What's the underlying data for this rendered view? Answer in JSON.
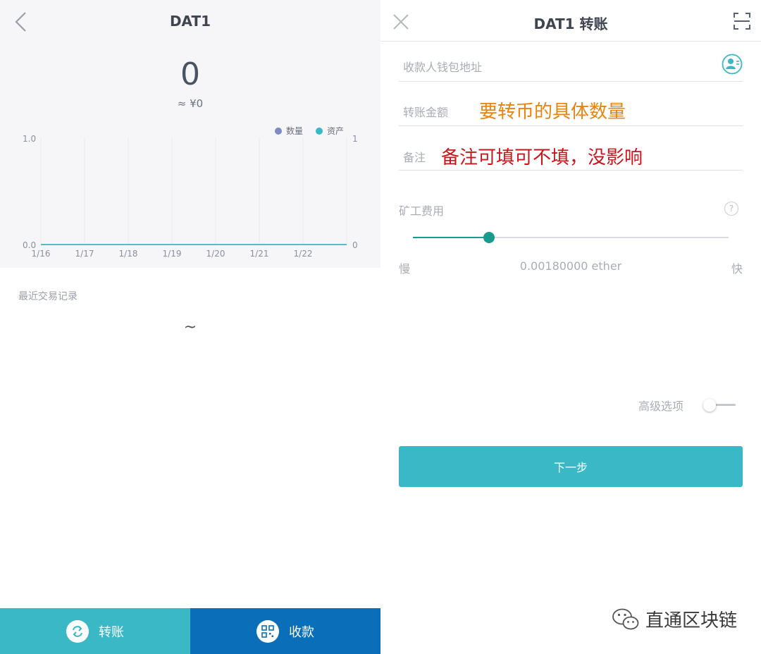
{
  "left": {
    "title": "DAT1",
    "balance": "0",
    "balance_fiat": "≈ ¥0",
    "records_label": "最近交易记录",
    "records_empty": "~",
    "bottom": {
      "transfer_label": "转账",
      "receive_label": "收款"
    }
  },
  "chart_data": {
    "type": "line",
    "x": [
      "1/16",
      "1/17",
      "1/18",
      "1/19",
      "1/20",
      "1/21",
      "1/22"
    ],
    "series": [
      {
        "name": "数量",
        "values": [
          0,
          0,
          0,
          0,
          0,
          0,
          0
        ],
        "color": "#7e8ac4"
      },
      {
        "name": "资产",
        "values": [
          0,
          0,
          0,
          0,
          0,
          0,
          0
        ],
        "color": "#3bb8c6"
      }
    ],
    "y_left_ticks": [
      "1.0",
      "0.0"
    ],
    "y_right_ticks": [
      "1",
      "0"
    ],
    "ylim": [
      0,
      1
    ],
    "grid": "vertical"
  },
  "right": {
    "title": "DAT1 转账",
    "recipient_placeholder": "收款人钱包地址",
    "amount_label": "转账金额",
    "amount_annotation": "要转币的具体数量",
    "memo_label": "备注",
    "memo_annotation": "备注可填可不填，没影响",
    "fee_label": "矿工费用",
    "fee_help": "?",
    "fee_level": 0.24,
    "fee_slow": "慢",
    "fee_value": "0.00180000 ether",
    "fee_fast": "快",
    "advanced_label": "高级选项",
    "advanced_on": false,
    "next_label": "下一步"
  },
  "watermark": "直通区块链",
  "colors": {
    "accent": "#3bb8c6",
    "receive": "#0a6fb8",
    "slider": "#169b8e",
    "annot_orange": "#e8830e",
    "annot_red": "#c8161d"
  }
}
